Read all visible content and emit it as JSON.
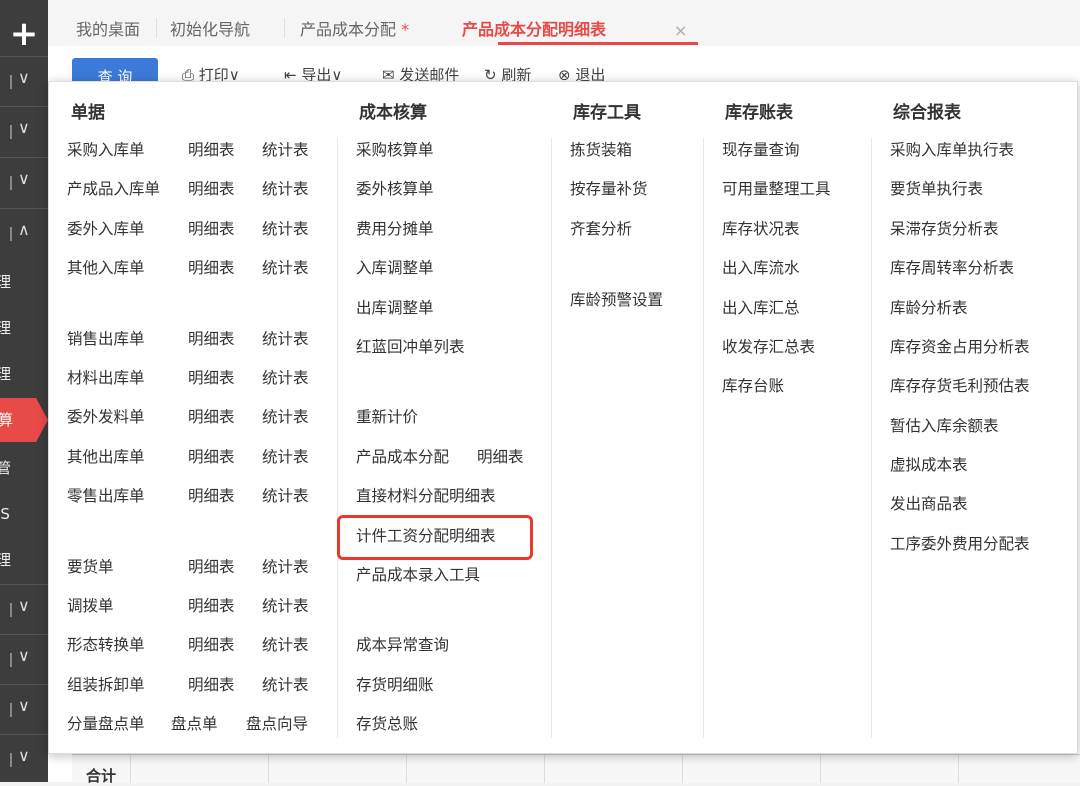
{
  "sidebar": {
    "plus": "+",
    "chevron_down": "∨",
    "chevron_up": "∧",
    "items": [
      "理",
      "理",
      "理",
      "算",
      "管",
      "IS",
      "理"
    ]
  },
  "tabs": [
    {
      "label": "我的桌面"
    },
    {
      "label": "初始化导航"
    },
    {
      "label": "产品成本分配",
      "modified_mark": "*"
    },
    {
      "label": "产品成本分配明细表",
      "close": "×"
    }
  ],
  "toolbar": {
    "query": "查 询",
    "print": "打印∨",
    "export": "导出∨",
    "email": "发送邮件",
    "refresh": "刷新",
    "exit": "退出"
  },
  "grid": {
    "footer_label": "合计"
  },
  "menu": {
    "col1": {
      "header": "单据",
      "rows": [
        [
          "采购入库单",
          "明细表",
          "统计表"
        ],
        [
          "产成品入库单",
          "明细表",
          "统计表"
        ],
        [
          "委外入库单",
          "明细表",
          "统计表"
        ],
        [
          "其他入库单",
          "明细表",
          "统计表"
        ],
        [
          "销售出库单",
          "明细表",
          "统计表"
        ],
        [
          "材料出库单",
          "明细表",
          "统计表"
        ],
        [
          "委外发料单",
          "明细表",
          "统计表"
        ],
        [
          "其他出库单",
          "明细表",
          "统计表"
        ],
        [
          "零售出库单",
          "明细表",
          "统计表"
        ],
        [
          "要货单",
          "明细表",
          "统计表"
        ],
        [
          "调拨单",
          "明细表",
          "统计表"
        ],
        [
          "形态转换单",
          "明细表",
          "统计表"
        ],
        [
          "组装拆卸单",
          "明细表",
          "统计表"
        ],
        [
          "分量盘点单",
          "盘点单",
          "盘点向导"
        ]
      ]
    },
    "col2": {
      "header": "成本核算",
      "items": [
        "采购核算单",
        "委外核算单",
        "费用分摊单",
        "入库调整单",
        "出库调整单",
        "红蓝回冲单列表",
        "重新计价",
        "产品成本分配",
        "直接材料分配明细表",
        "计件工资分配明细表",
        "产品成本录入工具",
        "成本异常查询",
        "存货明细账",
        "存货总账"
      ],
      "sub_detail": "明细表"
    },
    "col3": {
      "header": "库存工具",
      "items": [
        "拣货装箱",
        "按存量补货",
        "齐套分析",
        "库龄预警设置"
      ]
    },
    "col4": {
      "header": "库存账表",
      "items": [
        "现存量查询",
        "可用量整理工具",
        "库存状况表",
        "出入库流水",
        "出入库汇总",
        "收发存汇总表",
        "库存台账"
      ]
    },
    "col5": {
      "header": "综合报表",
      "items": [
        "采购入库单执行表",
        "要货单执行表",
        "呆滞存货分析表",
        "库存周转率分析表",
        "库龄分析表",
        "库存资金占用分析表",
        "库存存货毛利预估表",
        "暂估入库余额表",
        "虚拟成本表",
        "发出商品表",
        "工序委外费用分配表"
      ]
    },
    "highlight_color": "#e8392b"
  }
}
